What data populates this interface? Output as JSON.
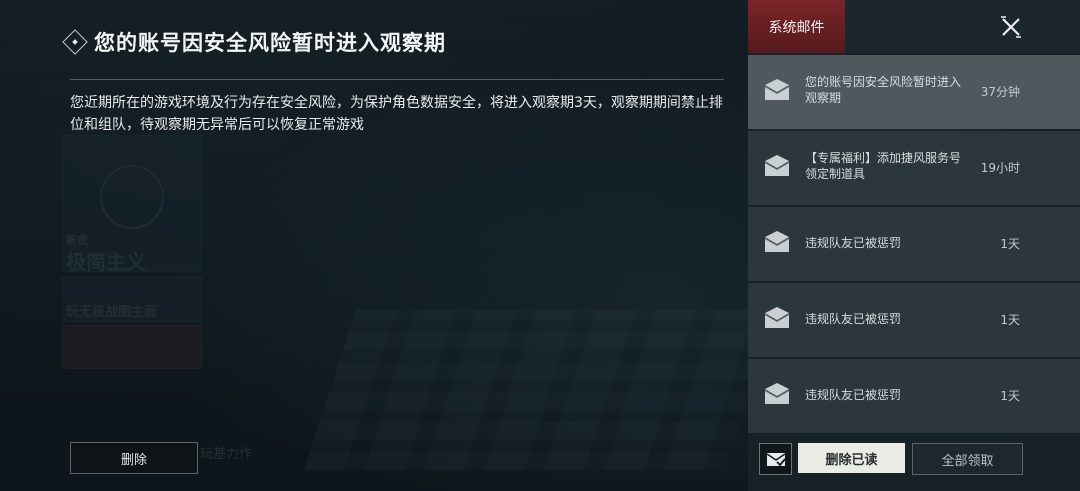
{
  "background": {
    "labels": [
      "新货",
      "极简主义",
      "玩无极战图主面",
      "玩基力作"
    ]
  },
  "notice": {
    "title": "您的账号因安全风险暂时进入观察期",
    "body": "您近期所在的游戏环境及行为存在安全风险，为保护角色数据安全，将进入观察期3天，观察期期间禁止排位和组队，待观察期无异常后可以恢复正常游戏",
    "delete_label": "删除"
  },
  "mail": {
    "tab_label": "系统邮件",
    "items": [
      {
        "subject": "您的账号因安全风险暂时进入观察期",
        "time": "37分钟",
        "active": true
      },
      {
        "subject": "【专属福利】添加捷风服务号领定制道具",
        "time": "19小时",
        "active": false
      },
      {
        "subject": "违规队友已被惩罚",
        "time": "1天",
        "active": false
      },
      {
        "subject": "违规队友已被惩罚",
        "time": "1天",
        "active": false
      },
      {
        "subject": "违规队友已被惩罚",
        "time": "1天",
        "active": false
      }
    ],
    "footer": {
      "delete_read_label": "删除已读",
      "claim_all_label": "全部领取"
    }
  },
  "colors": {
    "accent_red": "#7a2427",
    "panel_bg": "#18222a"
  }
}
